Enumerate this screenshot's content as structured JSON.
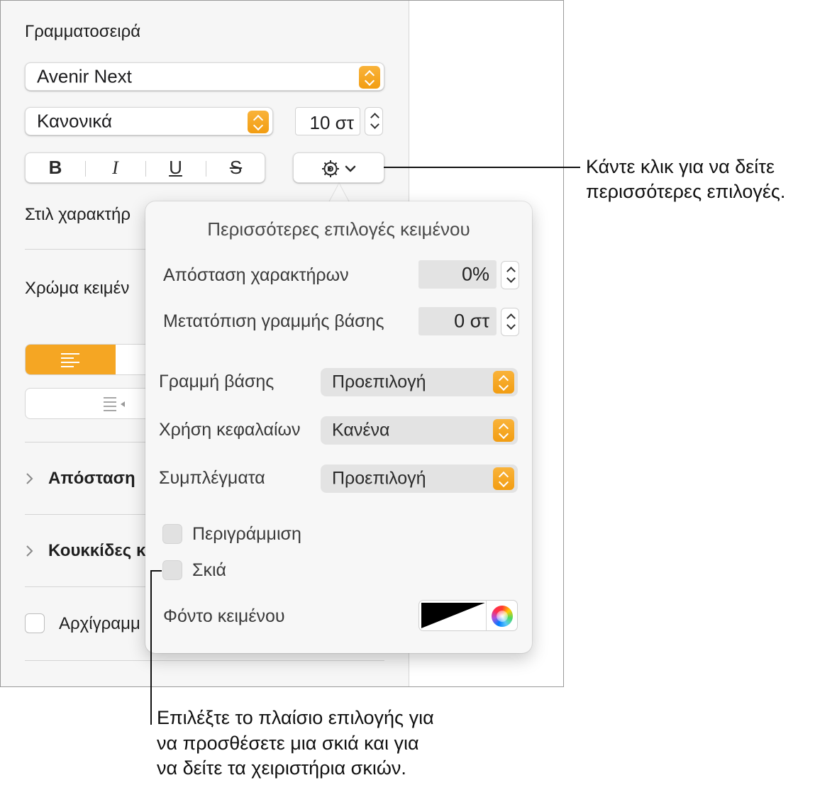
{
  "sidebar": {
    "font_heading": "Γραμματοσειρά",
    "font_family": "Avenir Next",
    "font_style": "Κανονικά",
    "font_size": "10 στ",
    "format_buttons": {
      "bold": "B",
      "italic": "I",
      "underline": "U",
      "strikethrough": "S"
    },
    "character_style_label": "Στιλ χαρακτήρ",
    "text_color_label": "Χρώμα κειμέν",
    "spacing_label": "Απόσταση",
    "bullets_label": "Κουκκίδες κ",
    "dropcap_label": "Αρχίγραμμ",
    "accent_color": "#f5a623"
  },
  "popover": {
    "title": "Περισσότερες επιλογές κειμένου",
    "character_spacing_label": "Απόσταση χαρακτήρων",
    "character_spacing_value": "0%",
    "baseline_shift_label": "Μετατόπιση γραμμής βάσης",
    "baseline_shift_value": "0 στ",
    "baseline_label": "Γραμμή βάσης",
    "baseline_value": "Προεπιλογή",
    "capitalization_label": "Χρήση κεφαλαίων",
    "capitalization_value": "Κανένα",
    "ligatures_label": "Συμπλέγματα",
    "ligatures_value": "Προεπιλογή",
    "outline_label": "Περιγράμμιση",
    "shadow_label": "Σκιά",
    "text_background_label": "Φόντο κειμένου"
  },
  "callouts": {
    "top_line1": "Κάντε κλικ για να δείτε",
    "top_line2": "περισσότερες επιλογές.",
    "bottom_line1": "Επιλέξτε το πλαίσιο επιλογής για",
    "bottom_line2": "να προσθέσετε μια σκιά και για",
    "bottom_line3": "να δείτε τα χειριστήρια σκιών."
  }
}
